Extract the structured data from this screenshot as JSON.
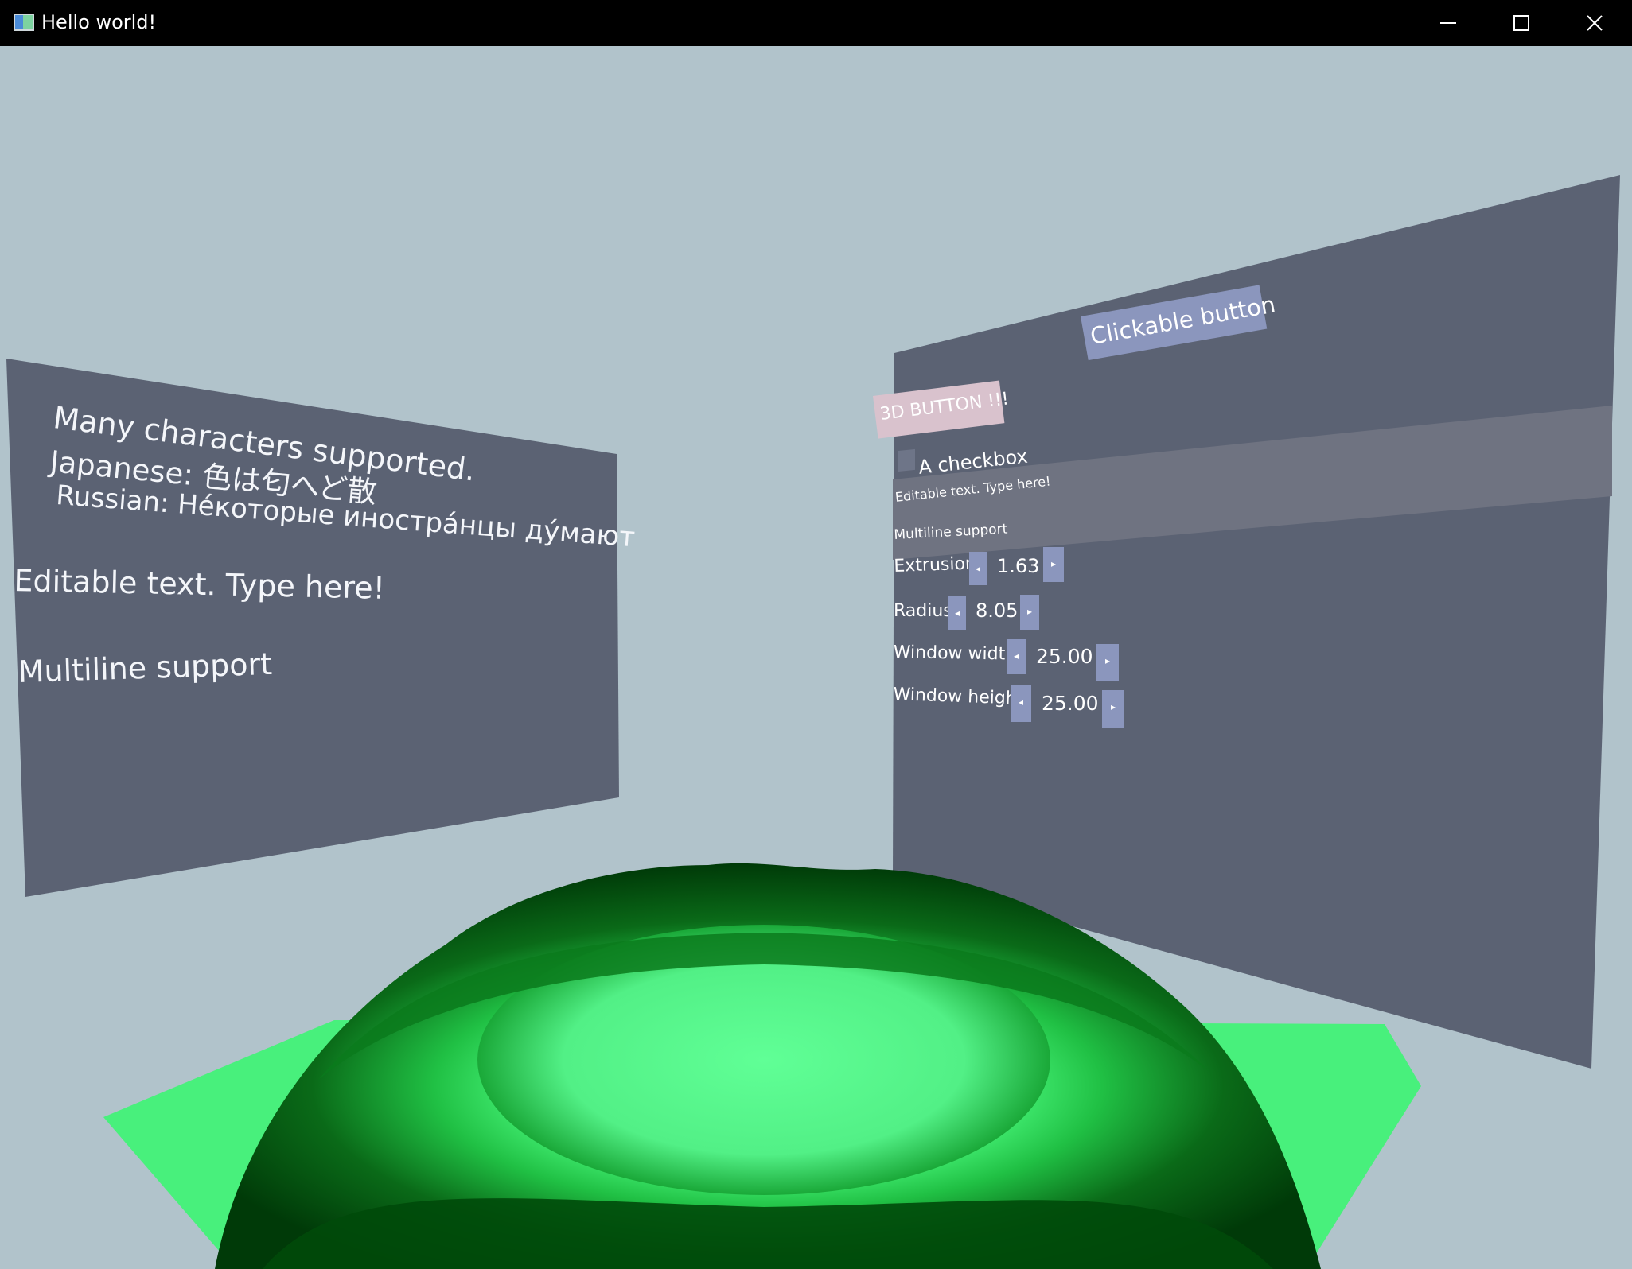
{
  "window": {
    "title": "Hello world!",
    "icon": "app-window-icon",
    "controls": {
      "minimize_icon": "minimize-icon",
      "maximize_icon": "maximize-icon",
      "close_icon": "close-icon"
    }
  },
  "colors": {
    "background": "#b1c3cb",
    "panel": "#5b6273",
    "panel_highlight": "#6f7381",
    "button_blue": "#8b96bd",
    "button_pink": "#d9c2cd",
    "terrain_bright": "#5cff8f",
    "terrain_dark": "#003300"
  },
  "left_panel": {
    "line1": "Many characters supported.",
    "line2": "Japanese: 色は匂へど散",
    "line3": "Russian: Не́которые иностра́нцы ду́мают",
    "editable": "Editable text. Type here!",
    "multiline": "Multiline support"
  },
  "right_panel": {
    "clickable_button": "Clickable button",
    "button_3d": "3D BUTTON !!!",
    "checkbox_label": "A checkbox",
    "editable": "Editable text. Type here!",
    "multiline": "Multiline support",
    "decrease_icon": "arrow-left-icon",
    "increase_icon": "arrow-right-icon",
    "sliders": [
      {
        "label": "Extrusion",
        "value": "1.63"
      },
      {
        "label": "Radius",
        "value": "8.05"
      },
      {
        "label": "Window width",
        "value": "25.00"
      },
      {
        "label": "Window height",
        "value": "25.00"
      }
    ]
  }
}
